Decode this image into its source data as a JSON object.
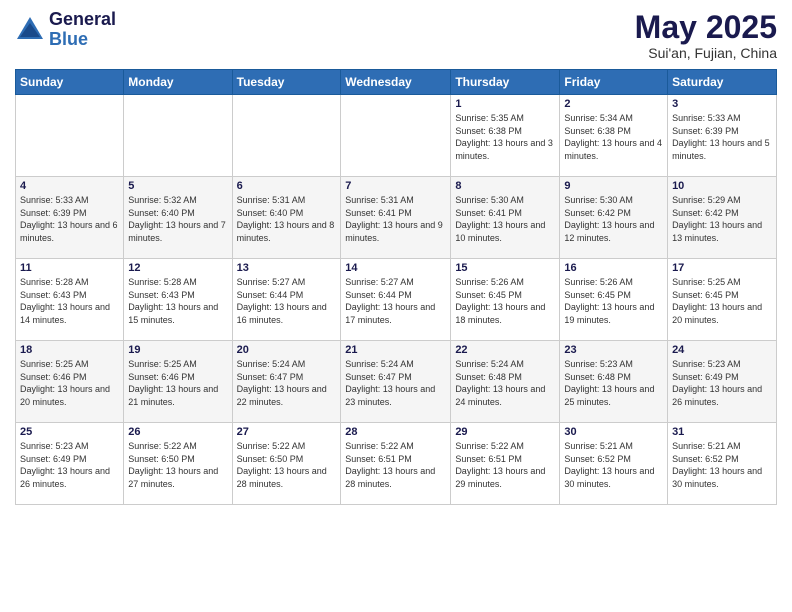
{
  "header": {
    "logo_general": "General",
    "logo_blue": "Blue",
    "month_title": "May 2025",
    "subtitle": "Sui'an, Fujian, China"
  },
  "days_of_week": [
    "Sunday",
    "Monday",
    "Tuesday",
    "Wednesday",
    "Thursday",
    "Friday",
    "Saturday"
  ],
  "weeks": [
    [
      {
        "day": "",
        "info": ""
      },
      {
        "day": "",
        "info": ""
      },
      {
        "day": "",
        "info": ""
      },
      {
        "day": "",
        "info": ""
      },
      {
        "day": "1",
        "info": "Sunrise: 5:35 AM\nSunset: 6:38 PM\nDaylight: 13 hours\nand 3 minutes."
      },
      {
        "day": "2",
        "info": "Sunrise: 5:34 AM\nSunset: 6:38 PM\nDaylight: 13 hours\nand 4 minutes."
      },
      {
        "day": "3",
        "info": "Sunrise: 5:33 AM\nSunset: 6:39 PM\nDaylight: 13 hours\nand 5 minutes."
      }
    ],
    [
      {
        "day": "4",
        "info": "Sunrise: 5:33 AM\nSunset: 6:39 PM\nDaylight: 13 hours\nand 6 minutes."
      },
      {
        "day": "5",
        "info": "Sunrise: 5:32 AM\nSunset: 6:40 PM\nDaylight: 13 hours\nand 7 minutes."
      },
      {
        "day": "6",
        "info": "Sunrise: 5:31 AM\nSunset: 6:40 PM\nDaylight: 13 hours\nand 8 minutes."
      },
      {
        "day": "7",
        "info": "Sunrise: 5:31 AM\nSunset: 6:41 PM\nDaylight: 13 hours\nand 9 minutes."
      },
      {
        "day": "8",
        "info": "Sunrise: 5:30 AM\nSunset: 6:41 PM\nDaylight: 13 hours\nand 10 minutes."
      },
      {
        "day": "9",
        "info": "Sunrise: 5:30 AM\nSunset: 6:42 PM\nDaylight: 13 hours\nand 12 minutes."
      },
      {
        "day": "10",
        "info": "Sunrise: 5:29 AM\nSunset: 6:42 PM\nDaylight: 13 hours\nand 13 minutes."
      }
    ],
    [
      {
        "day": "11",
        "info": "Sunrise: 5:28 AM\nSunset: 6:43 PM\nDaylight: 13 hours\nand 14 minutes."
      },
      {
        "day": "12",
        "info": "Sunrise: 5:28 AM\nSunset: 6:43 PM\nDaylight: 13 hours\nand 15 minutes."
      },
      {
        "day": "13",
        "info": "Sunrise: 5:27 AM\nSunset: 6:44 PM\nDaylight: 13 hours\nand 16 minutes."
      },
      {
        "day": "14",
        "info": "Sunrise: 5:27 AM\nSunset: 6:44 PM\nDaylight: 13 hours\nand 17 minutes."
      },
      {
        "day": "15",
        "info": "Sunrise: 5:26 AM\nSunset: 6:45 PM\nDaylight: 13 hours\nand 18 minutes."
      },
      {
        "day": "16",
        "info": "Sunrise: 5:26 AM\nSunset: 6:45 PM\nDaylight: 13 hours\nand 19 minutes."
      },
      {
        "day": "17",
        "info": "Sunrise: 5:25 AM\nSunset: 6:45 PM\nDaylight: 13 hours\nand 20 minutes."
      }
    ],
    [
      {
        "day": "18",
        "info": "Sunrise: 5:25 AM\nSunset: 6:46 PM\nDaylight: 13 hours\nand 20 minutes."
      },
      {
        "day": "19",
        "info": "Sunrise: 5:25 AM\nSunset: 6:46 PM\nDaylight: 13 hours\nand 21 minutes."
      },
      {
        "day": "20",
        "info": "Sunrise: 5:24 AM\nSunset: 6:47 PM\nDaylight: 13 hours\nand 22 minutes."
      },
      {
        "day": "21",
        "info": "Sunrise: 5:24 AM\nSunset: 6:47 PM\nDaylight: 13 hours\nand 23 minutes."
      },
      {
        "day": "22",
        "info": "Sunrise: 5:24 AM\nSunset: 6:48 PM\nDaylight: 13 hours\nand 24 minutes."
      },
      {
        "day": "23",
        "info": "Sunrise: 5:23 AM\nSunset: 6:48 PM\nDaylight: 13 hours\nand 25 minutes."
      },
      {
        "day": "24",
        "info": "Sunrise: 5:23 AM\nSunset: 6:49 PM\nDaylight: 13 hours\nand 26 minutes."
      }
    ],
    [
      {
        "day": "25",
        "info": "Sunrise: 5:23 AM\nSunset: 6:49 PM\nDaylight: 13 hours\nand 26 minutes."
      },
      {
        "day": "26",
        "info": "Sunrise: 5:22 AM\nSunset: 6:50 PM\nDaylight: 13 hours\nand 27 minutes."
      },
      {
        "day": "27",
        "info": "Sunrise: 5:22 AM\nSunset: 6:50 PM\nDaylight: 13 hours\nand 28 minutes."
      },
      {
        "day": "28",
        "info": "Sunrise: 5:22 AM\nSunset: 6:51 PM\nDaylight: 13 hours\nand 28 minutes."
      },
      {
        "day": "29",
        "info": "Sunrise: 5:22 AM\nSunset: 6:51 PM\nDaylight: 13 hours\nand 29 minutes."
      },
      {
        "day": "30",
        "info": "Sunrise: 5:21 AM\nSunset: 6:52 PM\nDaylight: 13 hours\nand 30 minutes."
      },
      {
        "day": "31",
        "info": "Sunrise: 5:21 AM\nSunset: 6:52 PM\nDaylight: 13 hours\nand 30 minutes."
      }
    ]
  ]
}
